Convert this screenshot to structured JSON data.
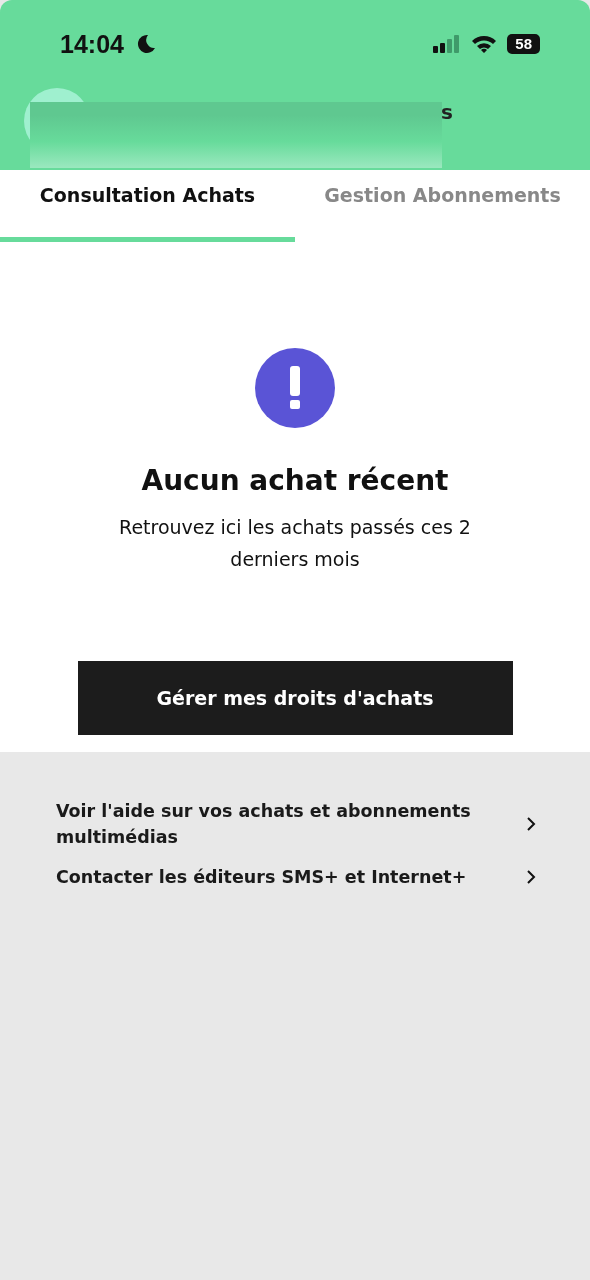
{
  "status_bar": {
    "time": "14:04",
    "battery": "58"
  },
  "header": {
    "title_fragment": "s"
  },
  "tabs": [
    {
      "label": "Consultation Achats",
      "selected": true
    },
    {
      "label": "Gestion Abonnements",
      "selected": false
    }
  ],
  "empty_state": {
    "title": "Aucun achat récent",
    "message": "Retrouvez ici les achats passés ces 2 derniers mois",
    "button": "Gérer mes droits d'achats"
  },
  "links": [
    {
      "label": "Voir l'aide sur vos achats et abonnements multimédias"
    },
    {
      "label": "Contacter les éditeurs SMS+ et Internet+"
    }
  ]
}
